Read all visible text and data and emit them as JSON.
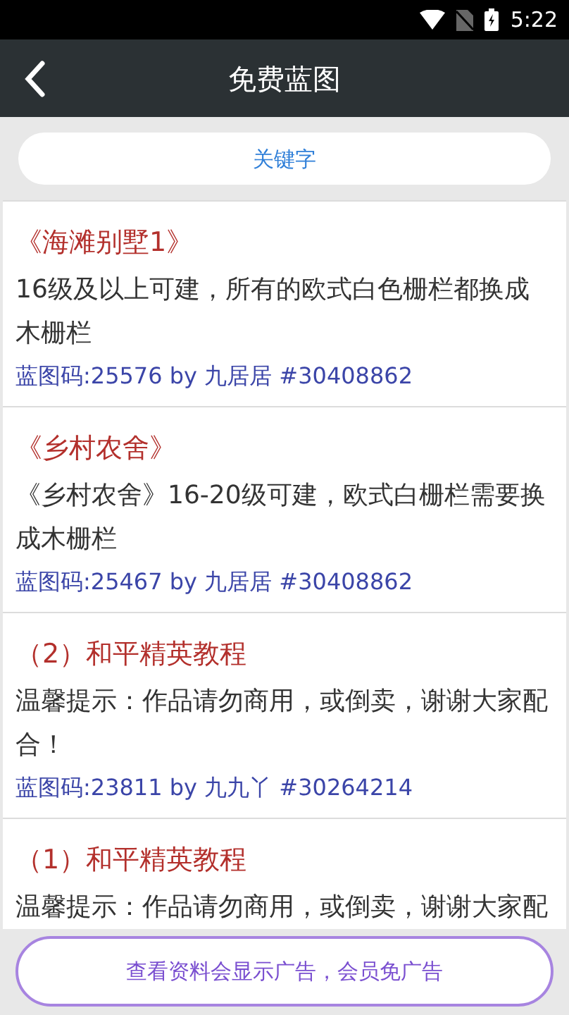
{
  "status_bar": {
    "time": "5:22"
  },
  "app_bar": {
    "title": "免费蓝图"
  },
  "search": {
    "placeholder": "关键字"
  },
  "items": [
    {
      "title": "《海滩别墅1》",
      "description": "16级及以上可建，所有的欧式白色栅栏都换成木栅栏",
      "meta": "蓝图码:25576 by 九居居 #30408862"
    },
    {
      "title": "《乡村农舍》",
      "description": "《乡村农舍》16-20级可建，欧式白栅栏需要换成木栅栏",
      "meta": "蓝图码:25467 by 九居居 #30408862"
    },
    {
      "title": "（2）和平精英教程",
      "description": "温馨提示：作品请勿商用，或倒卖，谢谢大家配合！",
      "meta": "蓝图码:23811 by 九九丫 #30264214"
    },
    {
      "title": "（1）和平精英教程",
      "description": "温馨提示：作品请勿商用，或倒卖，谢谢大家配"
    }
  ],
  "ad_button": {
    "label": "查看资料会显示广告，会员免广告"
  }
}
